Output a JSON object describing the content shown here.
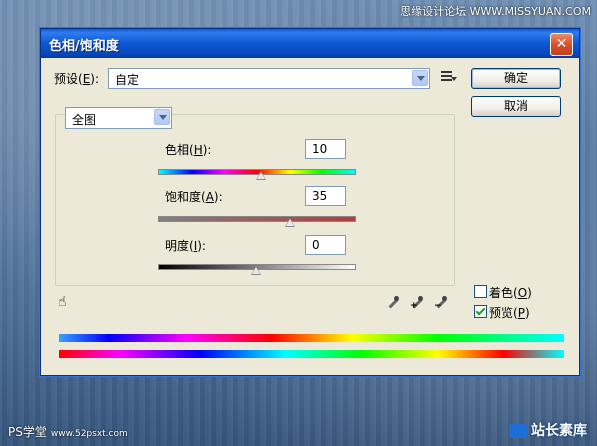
{
  "watermarks": {
    "top_right": "思缘设计论坛  WWW.MISSYUAN.COM",
    "bottom_left_main": "PS学堂",
    "bottom_left_sub": "www.52psxt.com",
    "bottom_right": "站长素库"
  },
  "dialog": {
    "title": "色相/饱和度",
    "close_symbol": "✕",
    "preset": {
      "label_prefix": "预设(",
      "label_key": "E",
      "label_suffix": "):",
      "value": "自定"
    },
    "buttons": {
      "ok": "确定",
      "cancel": "取消"
    },
    "channel": {
      "value": "全图"
    },
    "hue": {
      "label_prefix": "色相(",
      "label_key": "H",
      "label_suffix": "):",
      "value": "10",
      "min": -180,
      "max": 180
    },
    "saturation": {
      "label_prefix": "饱和度(",
      "label_key": "A",
      "label_suffix": "):",
      "value": "35",
      "min": -100,
      "max": 100
    },
    "lightness": {
      "label_prefix": "明度(",
      "label_key": "I",
      "label_suffix": "):",
      "value": "0",
      "min": -100,
      "max": 100
    },
    "colorize": {
      "label_prefix": "着色(",
      "label_key": "O",
      "label_suffix": ")",
      "checked": false
    },
    "preview": {
      "label_prefix": "预览(",
      "label_key": "P",
      "label_suffix": ")",
      "checked": true
    },
    "icons": {
      "hand": "targeted-adjustment-hand-icon",
      "eyedroppers": [
        "eyedropper-icon",
        "eyedropper-plus-icon",
        "eyedropper-minus-icon"
      ],
      "preset_menu": "preset-options-menu-icon"
    }
  }
}
